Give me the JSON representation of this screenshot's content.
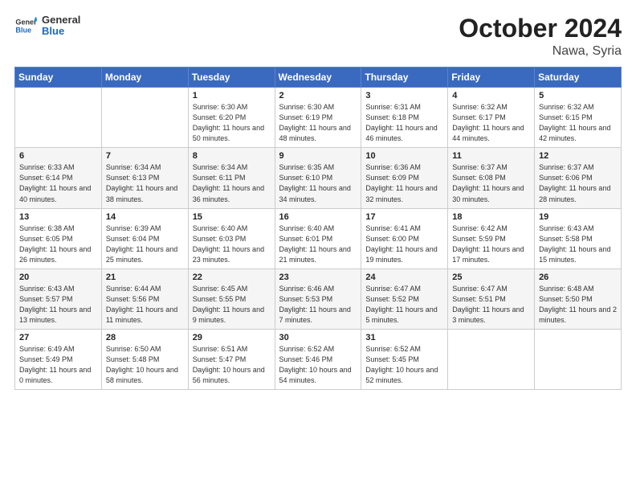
{
  "header": {
    "logo": {
      "line1": "General",
      "line2": "Blue"
    },
    "title": "October 2024",
    "location": "Nawa, Syria"
  },
  "weekdays": [
    "Sunday",
    "Monday",
    "Tuesday",
    "Wednesday",
    "Thursday",
    "Friday",
    "Saturday"
  ],
  "weeks": [
    [
      {
        "day": "",
        "sunrise": "",
        "sunset": "",
        "daylight": ""
      },
      {
        "day": "",
        "sunrise": "",
        "sunset": "",
        "daylight": ""
      },
      {
        "day": "1",
        "sunrise": "Sunrise: 6:30 AM",
        "sunset": "Sunset: 6:20 PM",
        "daylight": "Daylight: 11 hours and 50 minutes."
      },
      {
        "day": "2",
        "sunrise": "Sunrise: 6:30 AM",
        "sunset": "Sunset: 6:19 PM",
        "daylight": "Daylight: 11 hours and 48 minutes."
      },
      {
        "day": "3",
        "sunrise": "Sunrise: 6:31 AM",
        "sunset": "Sunset: 6:18 PM",
        "daylight": "Daylight: 11 hours and 46 minutes."
      },
      {
        "day": "4",
        "sunrise": "Sunrise: 6:32 AM",
        "sunset": "Sunset: 6:17 PM",
        "daylight": "Daylight: 11 hours and 44 minutes."
      },
      {
        "day": "5",
        "sunrise": "Sunrise: 6:32 AM",
        "sunset": "Sunset: 6:15 PM",
        "daylight": "Daylight: 11 hours and 42 minutes."
      }
    ],
    [
      {
        "day": "6",
        "sunrise": "Sunrise: 6:33 AM",
        "sunset": "Sunset: 6:14 PM",
        "daylight": "Daylight: 11 hours and 40 minutes."
      },
      {
        "day": "7",
        "sunrise": "Sunrise: 6:34 AM",
        "sunset": "Sunset: 6:13 PM",
        "daylight": "Daylight: 11 hours and 38 minutes."
      },
      {
        "day": "8",
        "sunrise": "Sunrise: 6:34 AM",
        "sunset": "Sunset: 6:11 PM",
        "daylight": "Daylight: 11 hours and 36 minutes."
      },
      {
        "day": "9",
        "sunrise": "Sunrise: 6:35 AM",
        "sunset": "Sunset: 6:10 PM",
        "daylight": "Daylight: 11 hours and 34 minutes."
      },
      {
        "day": "10",
        "sunrise": "Sunrise: 6:36 AM",
        "sunset": "Sunset: 6:09 PM",
        "daylight": "Daylight: 11 hours and 32 minutes."
      },
      {
        "day": "11",
        "sunrise": "Sunrise: 6:37 AM",
        "sunset": "Sunset: 6:08 PM",
        "daylight": "Daylight: 11 hours and 30 minutes."
      },
      {
        "day": "12",
        "sunrise": "Sunrise: 6:37 AM",
        "sunset": "Sunset: 6:06 PM",
        "daylight": "Daylight: 11 hours and 28 minutes."
      }
    ],
    [
      {
        "day": "13",
        "sunrise": "Sunrise: 6:38 AM",
        "sunset": "Sunset: 6:05 PM",
        "daylight": "Daylight: 11 hours and 26 minutes."
      },
      {
        "day": "14",
        "sunrise": "Sunrise: 6:39 AM",
        "sunset": "Sunset: 6:04 PM",
        "daylight": "Daylight: 11 hours and 25 minutes."
      },
      {
        "day": "15",
        "sunrise": "Sunrise: 6:40 AM",
        "sunset": "Sunset: 6:03 PM",
        "daylight": "Daylight: 11 hours and 23 minutes."
      },
      {
        "day": "16",
        "sunrise": "Sunrise: 6:40 AM",
        "sunset": "Sunset: 6:01 PM",
        "daylight": "Daylight: 11 hours and 21 minutes."
      },
      {
        "day": "17",
        "sunrise": "Sunrise: 6:41 AM",
        "sunset": "Sunset: 6:00 PM",
        "daylight": "Daylight: 11 hours and 19 minutes."
      },
      {
        "day": "18",
        "sunrise": "Sunrise: 6:42 AM",
        "sunset": "Sunset: 5:59 PM",
        "daylight": "Daylight: 11 hours and 17 minutes."
      },
      {
        "day": "19",
        "sunrise": "Sunrise: 6:43 AM",
        "sunset": "Sunset: 5:58 PM",
        "daylight": "Daylight: 11 hours and 15 minutes."
      }
    ],
    [
      {
        "day": "20",
        "sunrise": "Sunrise: 6:43 AM",
        "sunset": "Sunset: 5:57 PM",
        "daylight": "Daylight: 11 hours and 13 minutes."
      },
      {
        "day": "21",
        "sunrise": "Sunrise: 6:44 AM",
        "sunset": "Sunset: 5:56 PM",
        "daylight": "Daylight: 11 hours and 11 minutes."
      },
      {
        "day": "22",
        "sunrise": "Sunrise: 6:45 AM",
        "sunset": "Sunset: 5:55 PM",
        "daylight": "Daylight: 11 hours and 9 minutes."
      },
      {
        "day": "23",
        "sunrise": "Sunrise: 6:46 AM",
        "sunset": "Sunset: 5:53 PM",
        "daylight": "Daylight: 11 hours and 7 minutes."
      },
      {
        "day": "24",
        "sunrise": "Sunrise: 6:47 AM",
        "sunset": "Sunset: 5:52 PM",
        "daylight": "Daylight: 11 hours and 5 minutes."
      },
      {
        "day": "25",
        "sunrise": "Sunrise: 6:47 AM",
        "sunset": "Sunset: 5:51 PM",
        "daylight": "Daylight: 11 hours and 3 minutes."
      },
      {
        "day": "26",
        "sunrise": "Sunrise: 6:48 AM",
        "sunset": "Sunset: 5:50 PM",
        "daylight": "Daylight: 11 hours and 2 minutes."
      }
    ],
    [
      {
        "day": "27",
        "sunrise": "Sunrise: 6:49 AM",
        "sunset": "Sunset: 5:49 PM",
        "daylight": "Daylight: 11 hours and 0 minutes."
      },
      {
        "day": "28",
        "sunrise": "Sunrise: 6:50 AM",
        "sunset": "Sunset: 5:48 PM",
        "daylight": "Daylight: 10 hours and 58 minutes."
      },
      {
        "day": "29",
        "sunrise": "Sunrise: 6:51 AM",
        "sunset": "Sunset: 5:47 PM",
        "daylight": "Daylight: 10 hours and 56 minutes."
      },
      {
        "day": "30",
        "sunrise": "Sunrise: 6:52 AM",
        "sunset": "Sunset: 5:46 PM",
        "daylight": "Daylight: 10 hours and 54 minutes."
      },
      {
        "day": "31",
        "sunrise": "Sunrise: 6:52 AM",
        "sunset": "Sunset: 5:45 PM",
        "daylight": "Daylight: 10 hours and 52 minutes."
      },
      {
        "day": "",
        "sunrise": "",
        "sunset": "",
        "daylight": ""
      },
      {
        "day": "",
        "sunrise": "",
        "sunset": "",
        "daylight": ""
      }
    ]
  ]
}
